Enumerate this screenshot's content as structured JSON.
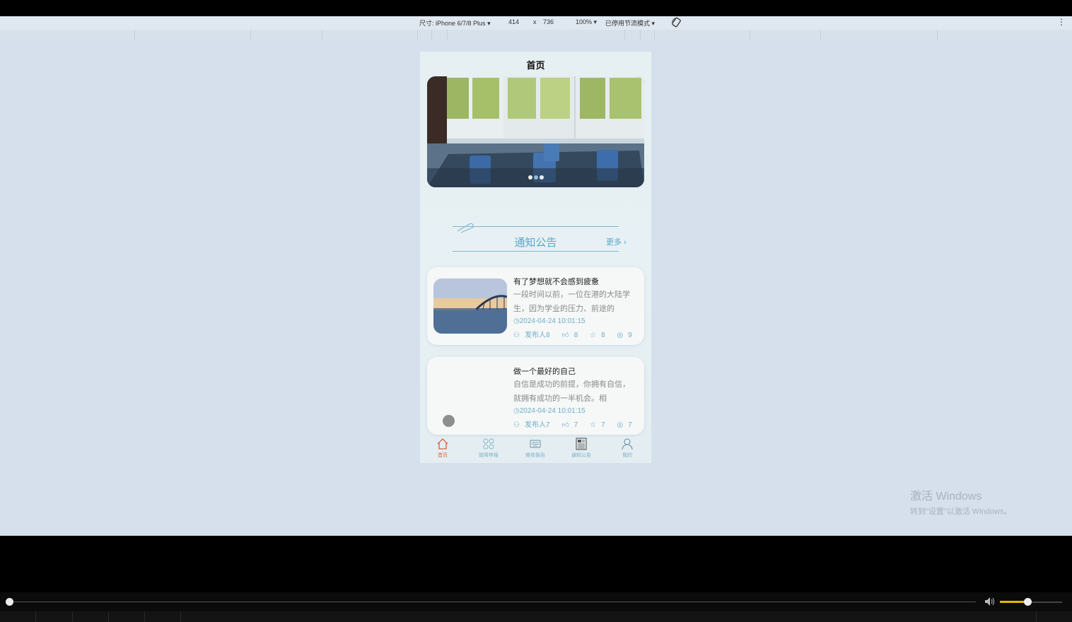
{
  "devtools": {
    "device": "尺寸: iPhone 6/7/8 Plus",
    "width": "414",
    "times": "x",
    "height": "736",
    "zoom": "100%",
    "throttle": "已停用节流模式",
    "rotate_icon": "rotate-icon",
    "more_icon": "kebab-icon"
  },
  "page": {
    "title": "首页",
    "banner": {
      "slides": 3,
      "active_slide": 2
    }
  },
  "notice": {
    "title": "通知公告",
    "more": "更多",
    "more_icon": "chevron-right-icon",
    "items": [
      {
        "title": "有了梦想就不会感到疲惫",
        "desc": "一段时间以前，一位在港的大陆学生，因为学业的压力、前途的",
        "time": "2024-04-24 10:01:15",
        "author": "发布人8",
        "likes": "8",
        "favorites": "8",
        "views": "9"
      },
      {
        "title": "做一个最好的自己",
        "desc": "自信是成功的前提，你拥有自信，就拥有成功的一半机会。相",
        "time": "2024-04-24 10:01:15",
        "author": "发布人7",
        "likes": "7",
        "favorites": "7",
        "views": "7"
      }
    ]
  },
  "tabbar": {
    "items": [
      {
        "label": "首页",
        "icon": "home-icon",
        "active": true
      },
      {
        "label": "故障申报",
        "icon": "grid-icon",
        "active": false
      },
      {
        "label": "维修报告",
        "icon": "keyboard-icon",
        "active": false
      },
      {
        "label": "通知公告",
        "icon": "newspaper-icon",
        "active": false
      },
      {
        "label": "我的",
        "icon": "user-icon",
        "active": false
      }
    ]
  },
  "watermark": {
    "line1": "激活 Windows",
    "line2": "转到\"设置\"以激活 Windows。"
  },
  "colors": {
    "accent": "#5aa6c4",
    "active_tab": "#d9603e",
    "volume": "#e6b800"
  },
  "player": {
    "progress": 0.0,
    "volume": 0.44
  }
}
